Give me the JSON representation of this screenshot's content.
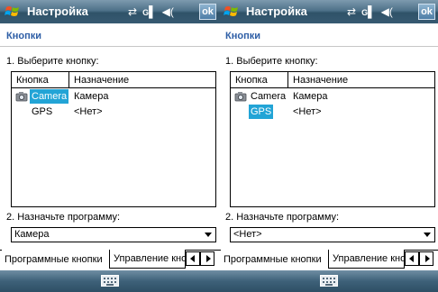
{
  "colors": {
    "titlebar": "#4e7189",
    "heading": "#2e5ea6",
    "selection": "#22a4d6",
    "bottombar": "#3e6179"
  },
  "screens": [
    {
      "title": "Настройка",
      "status_icons": [
        "sync-icon",
        "signal-icon",
        "volume-icon"
      ],
      "network_letter": "G",
      "ok_label": "ok",
      "section_heading": "Кнопки",
      "step1_label": "1. Выберите кнопку:",
      "list": {
        "headers": [
          "Кнопка",
          "Назначение"
        ],
        "rows": [
          {
            "button": "Camera",
            "assignment": "Камера",
            "icon": "camera-icon",
            "selected": true
          },
          {
            "button": "GPS",
            "assignment": "<Нет>",
            "icon": "",
            "selected": false
          }
        ]
      },
      "step2_label": "2. Назначьте программу:",
      "program_value": "Камера",
      "tabs": [
        "Программные кнопки",
        "Управление кноп"
      ],
      "bottom_icon": "keyboard-icon"
    },
    {
      "title": "Настройка",
      "status_icons": [
        "sync-icon",
        "signal-icon",
        "volume-icon"
      ],
      "network_letter": "G",
      "ok_label": "ok",
      "section_heading": "Кнопки",
      "step1_label": "1. Выберите кнопку:",
      "list": {
        "headers": [
          "Кнопка",
          "Назначение"
        ],
        "rows": [
          {
            "button": "Camera",
            "assignment": "Камера",
            "icon": "camera-icon",
            "selected": false
          },
          {
            "button": "GPS",
            "assignment": "<Нет>",
            "icon": "",
            "selected": true
          }
        ]
      },
      "step2_label": "2. Назначьте программу:",
      "program_value": "<Нет>",
      "tabs": [
        "Программные кнопки",
        "Управление кноп"
      ],
      "bottom_icon": "keyboard-icon"
    }
  ]
}
